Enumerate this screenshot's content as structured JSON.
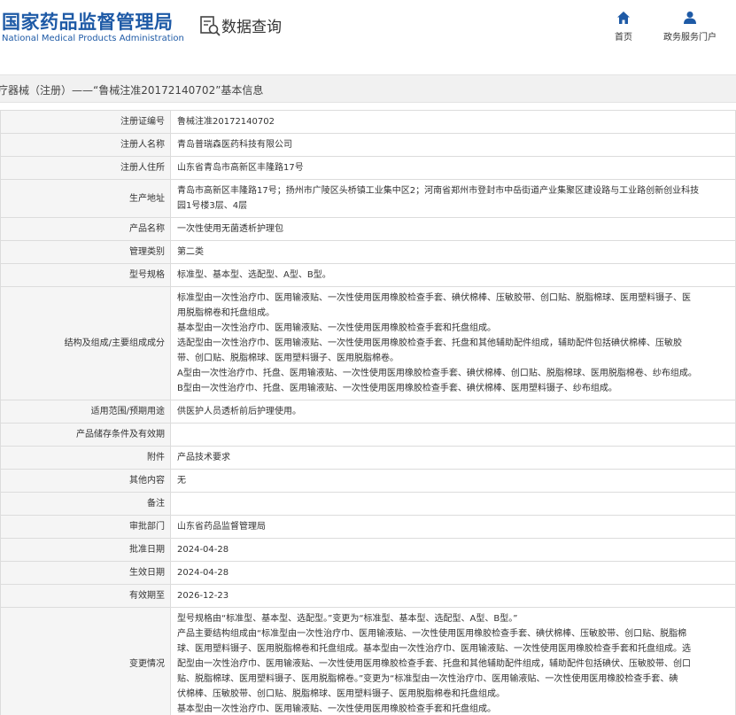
{
  "header": {
    "logo_cn": "国家药品监督管理局",
    "logo_en": "National Medical Products Administration",
    "query_title": "数据查询",
    "nav": [
      {
        "label": "首页",
        "icon": "home-icon"
      },
      {
        "label": "政务服务门户",
        "icon": "user-icon"
      }
    ],
    "brand_color": "#1e5aa6"
  },
  "breadcrumb": "疗器械（注册）——“鲁械注准20172140702”基本信息",
  "details": {
    "rows": [
      {
        "label": "注册证编号",
        "value": "鲁械注准20172140702"
      },
      {
        "label": "注册人名称",
        "value": "青岛普瑞森医药科技有限公司"
      },
      {
        "label": "注册人住所",
        "value": "山东省青岛市高新区丰隆路17号"
      },
      {
        "label": "生产地址",
        "lines": [
          "青岛市高新区丰隆路17号；扬州市广陵区头桥镇工业集中区2；河南省郑州市登封市中岳街道产业集聚区建设路与工业路创新创业科技",
          "园1号楼3层、4层"
        ]
      },
      {
        "label": "产品名称",
        "value": "一次性使用无菌透析护理包"
      },
      {
        "label": "管理类别",
        "value": "第二类"
      },
      {
        "label": "型号规格",
        "value": "标准型、基本型、选配型、A型、B型。"
      },
      {
        "label": "结构及组成/主要组成成分",
        "lines": [
          "标准型由一次性治疗巾、医用输液贴、一次性使用医用橡胶检查手套、碘伏棉棒、压敏胶带、创口贴、脱脂棉球、医用塑料镊子、医",
          "用脱脂棉卷和托盘组成。",
          "基本型由一次性治疗巾、医用输液贴、一次性使用医用橡胶检查手套和托盘组成。",
          "选配型由一次性治疗巾、医用输液贴、一次性使用医用橡胶检查手套、托盘和其他辅助配件组成，辅助配件包括碘伏棉棒、压敏胶",
          "带、创口贴、脱脂棉球、医用塑料镊子、医用脱脂棉卷。",
          "A型由一次性治疗巾、托盘、医用输液贴、一次性使用医用橡胶检查手套、碘伏棉棒、创口贴、脱脂棉球、医用脱脂棉卷、纱布组成。",
          "B型由一次性治疗巾、托盘、医用输液贴、一次性使用医用橡胶检查手套、碘伏棉棒、医用塑料镊子、纱布组成。"
        ]
      },
      {
        "label": "适用范围/预期用途",
        "value": "供医护人员透析前后护理使用。"
      },
      {
        "label": "产品储存条件及有效期",
        "value": ""
      },
      {
        "label": "附件",
        "value": "产品技术要求"
      },
      {
        "label": "其他内容",
        "value": "无"
      },
      {
        "label": "备注",
        "value": ""
      },
      {
        "label": "审批部门",
        "value": "山东省药品监督管理局"
      },
      {
        "label": "批准日期",
        "value": "2024-04-28"
      },
      {
        "label": "生效日期",
        "value": "2024-04-28"
      },
      {
        "label": "有效期至",
        "value": "2026-12-23"
      },
      {
        "label": "变更情况",
        "lines": [
          "型号规格由“标准型、基本型、选配型。”变更为“标准型、基本型、选配型、A型、B型。”",
          "产品主要结构组成由“标准型由一次性治疗巾、医用输液贴、一次性使用医用橡胶检查手套、碘伏棉棒、压敏胶带、创口贴、脱脂棉",
          "球、医用塑料镊子、医用脱脂棉卷和托盘组成。基本型由一次性治疗巾、医用输液贴、一次性使用医用橡胶检查手套和托盘组成。选",
          "配型由一次性治疗巾、医用输液贴、一次性使用医用橡胶检查手套、托盘和其他辅助配件组成，辅助配件包括碘伏、压敏胶带、创口",
          "贴、脱脂棉球、医用塑料镊子、医用脱脂棉卷。”变更为“标准型由一次性治疗巾、医用输液贴、一次性使用医用橡胶检查手套、碘",
          "伏棉棒、压敏胶带、创口贴、脱脂棉球、医用塑料镊子、医用脱脂棉卷和托盘组成。",
          "基本型由一次性治疗巾、医用输液贴、一次性使用医用橡胶检查手套和托盘组成。"
        ]
      }
    ]
  }
}
